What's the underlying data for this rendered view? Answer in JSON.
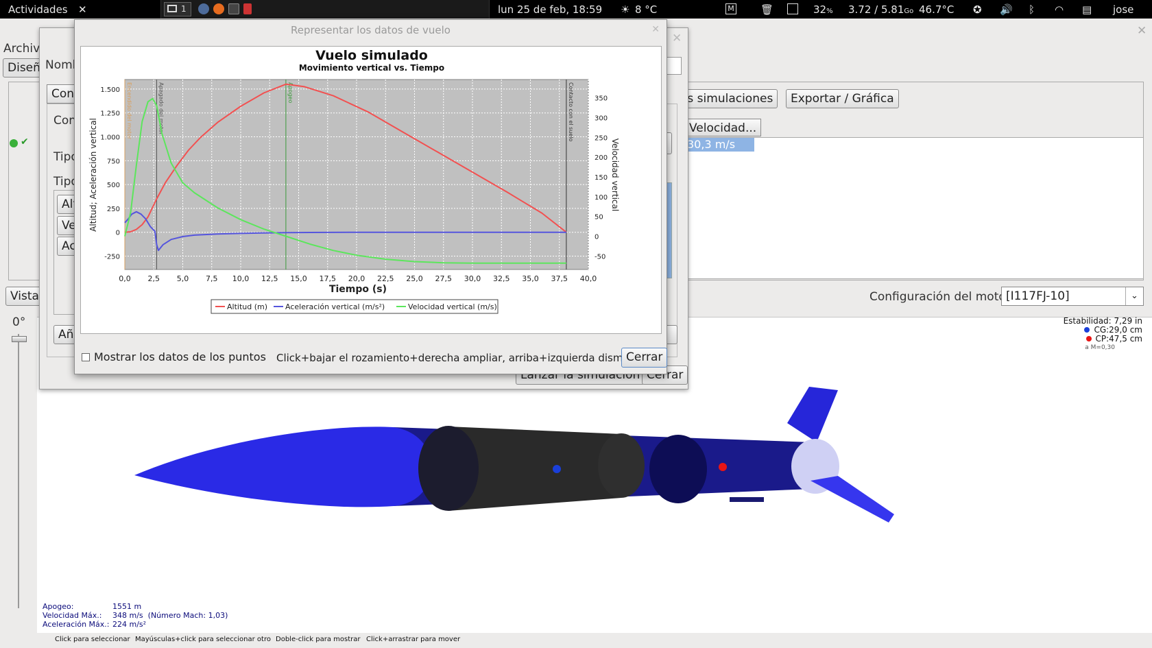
{
  "topbar": {
    "activities": "Actividades",
    "close_glyph": "✕",
    "workspace": "1",
    "clock": "lun 25 de feb, 18:59",
    "weather": "8 °C",
    "cpu": "32",
    "cpu_unit": "%",
    "load": "3.72 / 5.81",
    "load_unit": "Go",
    "temp": "46.7°C",
    "user": "jose"
  },
  "background_window": {
    "menu_archivo": "Archivo",
    "tab_diseno": "Diseño",
    "btn_simulaciones": "as simulaciones",
    "btn_exportar": "Exportar / Gráfica",
    "col_velocidad": "Velocidad...",
    "cell_velocidad": "30,3 m/s",
    "vista_label": "Vista",
    "angle": "0°",
    "motor_config_label": "Configuración del motor",
    "motor_config_value": "[I117FJ-10]",
    "stability": "Estabilidad:  7,29 in",
    "cg": "CG:29,0 cm",
    "cp": "CP:47,5 cm",
    "mach_note": "a M=0,30",
    "info": {
      "apogee_label": "Apogeo:",
      "apogee_value": "1551 m",
      "vmax_label": "Velocidad Máx.:",
      "vmax_value": "348 m/s",
      "vmax_mach": "(Número Mach:  1,03)",
      "amax_label": "Aceleración Máx.:",
      "amax_value": "224 m/s²"
    },
    "status": {
      "s1": "Click para seleccionar",
      "s2": "Mayúsculas+click para seleccionar otro",
      "s3": "Doble-click para mostrar",
      "s4": "Click+arrastrar para mover"
    }
  },
  "mid_dialog": {
    "nombre_label": "Nomb",
    "tab_con": "Con",
    "con_label": "Con",
    "tipo1": "Tipo",
    "tipo2": "Tipo",
    "item_alt": "Alt",
    "item_ve": "Ve",
    "item_ac": "Ac",
    "btn_anadir": "Añ",
    "btn_lanzar": "Lanzar la simulación",
    "btn_cerrar": "Cerrar"
  },
  "plot_dialog": {
    "title": "Representar los datos de vuelo",
    "show_points": "Mostrar los datos de los puntos",
    "hint": "Click+bajar el rozamiento+derecha ampliar, arriba+izquierda disminuir",
    "close_button": "Cerrar"
  },
  "chart_data": {
    "type": "line",
    "title": "Vuelo simulado",
    "subtitle": "Movimiento vertical vs. Tiempo",
    "xlabel": "Tiempo (s)",
    "ylabel_left": "Altitud; Aceleración vertical",
    "ylabel_right": "Velocidad vertical",
    "xlim": [
      0,
      40
    ],
    "ylim_left": [
      -390,
      1600
    ],
    "ylim_right": [
      -84,
      396
    ],
    "x_ticks": [
      "0,0",
      "2,5",
      "5,0",
      "7,5",
      "10,0",
      "12,5",
      "15,0",
      "17,5",
      "20,0",
      "22,5",
      "25,0",
      "27,5",
      "30,0",
      "32,5",
      "35,0",
      "37,5",
      "40,0"
    ],
    "y_left_ticks": [
      "1.500",
      "1.250",
      "1.000",
      "750",
      "500",
      "250",
      "0",
      "-250"
    ],
    "y_right_ticks": [
      "350",
      "300",
      "250",
      "200",
      "150",
      "100",
      "50",
      "0",
      "-50"
    ],
    "grid": true,
    "legend_position": "bottom",
    "events": [
      {
        "t": 0.0,
        "label": "Encendido del motor",
        "color": "#d9a060"
      },
      {
        "t": 2.75,
        "label": "Apagado del motor",
        "color": "#555555"
      },
      {
        "t": 13.9,
        "label": "Apogeo",
        "color": "#3a9a3a"
      },
      {
        "t": 38.1,
        "label": "Contacto con el suelo",
        "color": "#333333"
      }
    ],
    "series": [
      {
        "name": "Altitud (m)",
        "axis": "left",
        "color": "#f25050",
        "x": [
          0,
          0.5,
          1,
          1.5,
          2,
          2.75,
          3.5,
          4.5,
          5.5,
          6.5,
          8,
          10,
          12,
          13.9,
          15.5,
          18,
          21,
          24,
          27,
          30,
          33,
          36,
          38.1
        ],
        "y": [
          0,
          5,
          30,
          80,
          160,
          350,
          520,
          700,
          860,
          990,
          1150,
          1320,
          1460,
          1551,
          1525,
          1430,
          1260,
          1050,
          840,
          630,
          420,
          200,
          0
        ]
      },
      {
        "name": "Aceleración vertical (m/s²)",
        "axis": "left",
        "color": "#5555dd",
        "x": [
          0,
          0.3,
          0.6,
          1.0,
          1.4,
          1.8,
          2.2,
          2.6,
          2.75,
          2.9,
          3.3,
          4,
          5,
          6,
          8,
          10,
          12,
          13.9,
          16,
          20,
          25,
          30,
          35,
          38.1
        ],
        "y": [
          100,
          140,
          190,
          215,
          190,
          140,
          60,
          10,
          -130,
          -190,
          -130,
          -75,
          -45,
          -30,
          -18,
          -12,
          -7,
          -4,
          -2,
          0,
          0,
          0,
          0,
          0
        ]
      },
      {
        "name": "Velocidad vertical (m/s)",
        "axis": "right",
        "color": "#5ce65c",
        "x": [
          0,
          0.5,
          1,
          1.5,
          2,
          2.4,
          2.75,
          3.2,
          4,
          5,
          6,
          8,
          10,
          12,
          13.9,
          16,
          18,
          20,
          22.5,
          25,
          27.5,
          30,
          35,
          38.1
        ],
        "y": [
          0,
          60,
          180,
          290,
          340,
          348,
          330,
          260,
          185,
          135,
          110,
          72,
          42,
          18,
          0,
          -20,
          -36,
          -48,
          -58,
          -64,
          -67,
          -68,
          -68,
          -68
        ]
      }
    ]
  }
}
